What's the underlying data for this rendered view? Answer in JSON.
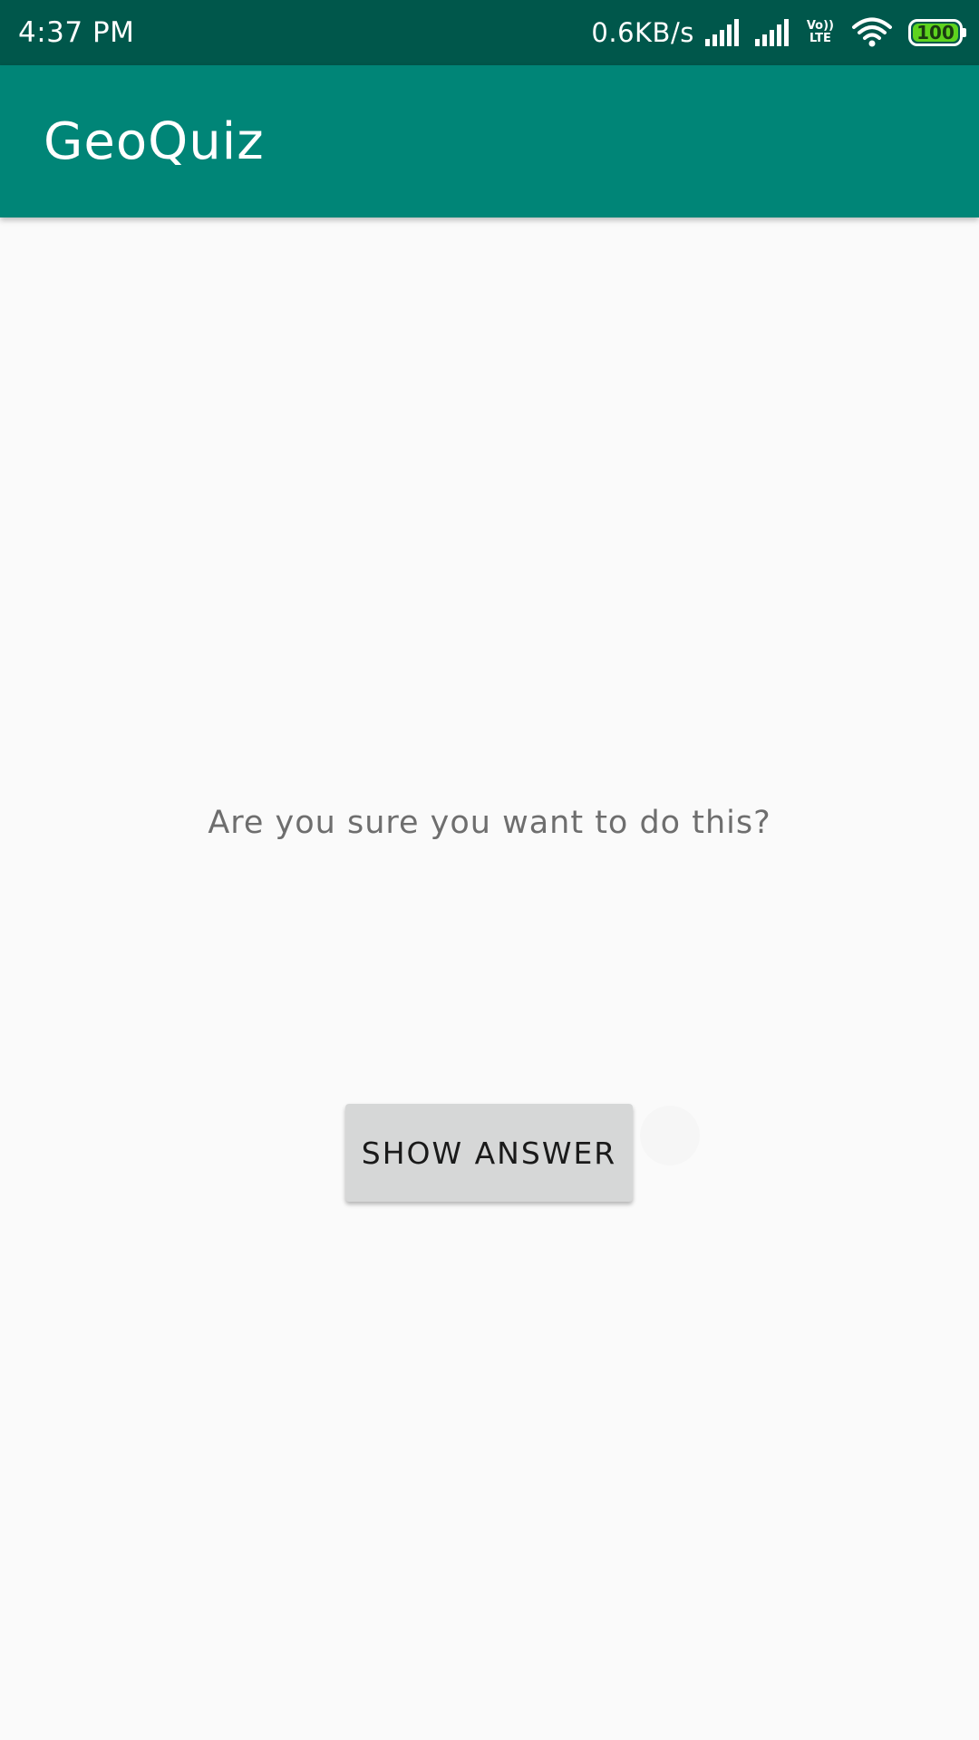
{
  "status_bar": {
    "time": "4:37 PM",
    "net_speed": "0.6KB/s",
    "volte_top": "Vo))",
    "volte_bottom": "LTE",
    "battery_level": "100",
    "battery_color": "#5ED31E",
    "icons": [
      "signal-icon",
      "signal-icon",
      "volte-icon",
      "wifi-icon",
      "battery-icon"
    ]
  },
  "app_bar": {
    "title": "GeoQuiz",
    "color": "#008577"
  },
  "main": {
    "warning_text": "Are you sure you want to do this?",
    "show_answer_label": "SHOW ANSWER"
  }
}
